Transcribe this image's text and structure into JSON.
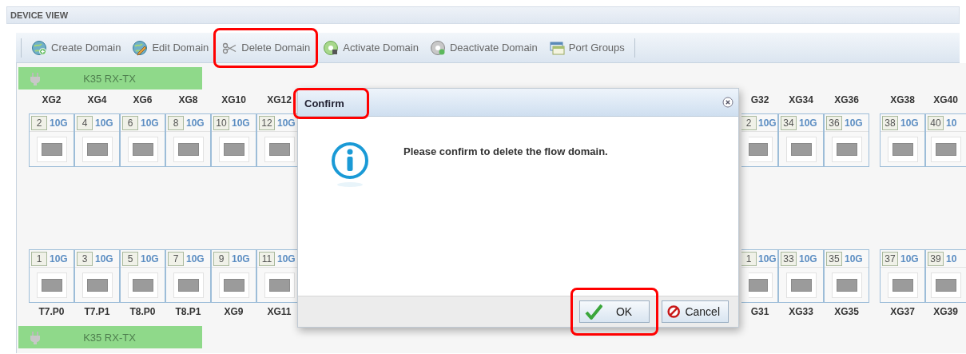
{
  "header": {
    "title": "DEVICE VIEW"
  },
  "toolbar": [
    {
      "label": "Create Domain",
      "kind": "create",
      "highlighted": false
    },
    {
      "label": "Edit Domain",
      "kind": "edit",
      "highlighted": false
    },
    {
      "label": "Delete Domain",
      "kind": "delete",
      "highlighted": true
    },
    {
      "label": "Activate Domain",
      "kind": "activate",
      "highlighted": false
    },
    {
      "label": "Deactivate Domain",
      "kind": "deactivate",
      "highlighted": false
    },
    {
      "label": "Port Groups",
      "kind": "groups",
      "highlighted": false
    }
  ],
  "domain_bars": [
    {
      "label": "K35 RX-TX"
    },
    {
      "label": "K35 RX-TX"
    }
  ],
  "port_groups": [
    {
      "columns": [
        {
          "kind": "full",
          "top_label": "XG2",
          "top_number": "2",
          "top_speed": "10G",
          "bottom_number": "1",
          "bottom_speed": "10G",
          "bottom_label": "T7.P0"
        },
        {
          "kind": "full",
          "top_label": "XG4",
          "top_number": "4",
          "top_speed": "10G",
          "bottom_number": "3",
          "bottom_speed": "10G",
          "bottom_label": "T7.P1"
        },
        {
          "kind": "full",
          "top_label": "XG6",
          "top_number": "6",
          "top_speed": "10G",
          "bottom_number": "5",
          "bottom_speed": "10G",
          "bottom_label": "T8.P0"
        },
        {
          "kind": "full",
          "top_label": "XG8",
          "top_number": "8",
          "top_speed": "10G",
          "bottom_number": "7",
          "bottom_speed": "10G",
          "bottom_label": "T8.P1"
        },
        {
          "kind": "full",
          "top_label": "XG10",
          "top_number": "10",
          "top_speed": "10G",
          "bottom_number": "9",
          "bottom_speed": "10G",
          "bottom_label": "XG9"
        },
        {
          "kind": "full",
          "top_label": "XG12",
          "top_number": "12",
          "top_speed": "10G",
          "bottom_number": "11",
          "bottom_speed": "10G",
          "bottom_label": "XG11"
        }
      ]
    },
    {
      "columns": [
        {
          "kind": "cut-left",
          "top_label": "G32",
          "top_number": "2",
          "top_speed": "10G",
          "bottom_number": "1",
          "bottom_speed": "10G",
          "bottom_label": "G31"
        },
        {
          "kind": "full",
          "top_label": "XG34",
          "top_number": "34",
          "top_speed": "10G",
          "bottom_number": "33",
          "bottom_speed": "10G",
          "bottom_label": "XG33"
        },
        {
          "kind": "full",
          "top_label": "XG36",
          "top_number": "36",
          "top_speed": "10G",
          "bottom_number": "35",
          "bottom_speed": "10G",
          "bottom_label": "XG35"
        }
      ]
    },
    {
      "columns": [
        {
          "kind": "full",
          "top_label": "XG38",
          "top_number": "38",
          "top_speed": "10G",
          "bottom_number": "37",
          "bottom_speed": "10G",
          "bottom_label": "XG37"
        },
        {
          "kind": "cut-right",
          "top_label": "XG40",
          "top_number": "40",
          "top_speed": "10",
          "bottom_number": "39",
          "bottom_speed": "10",
          "bottom_label": "XG39"
        }
      ]
    }
  ],
  "dialog": {
    "title": "Confirm",
    "title_highlighted": true,
    "message": "Please confirm to delete the flow domain.",
    "buttons": [
      {
        "label": "OK",
        "kind": "ok",
        "highlighted": true
      },
      {
        "label": "Cancel",
        "kind": "cancel",
        "highlighted": false
      }
    ]
  }
}
